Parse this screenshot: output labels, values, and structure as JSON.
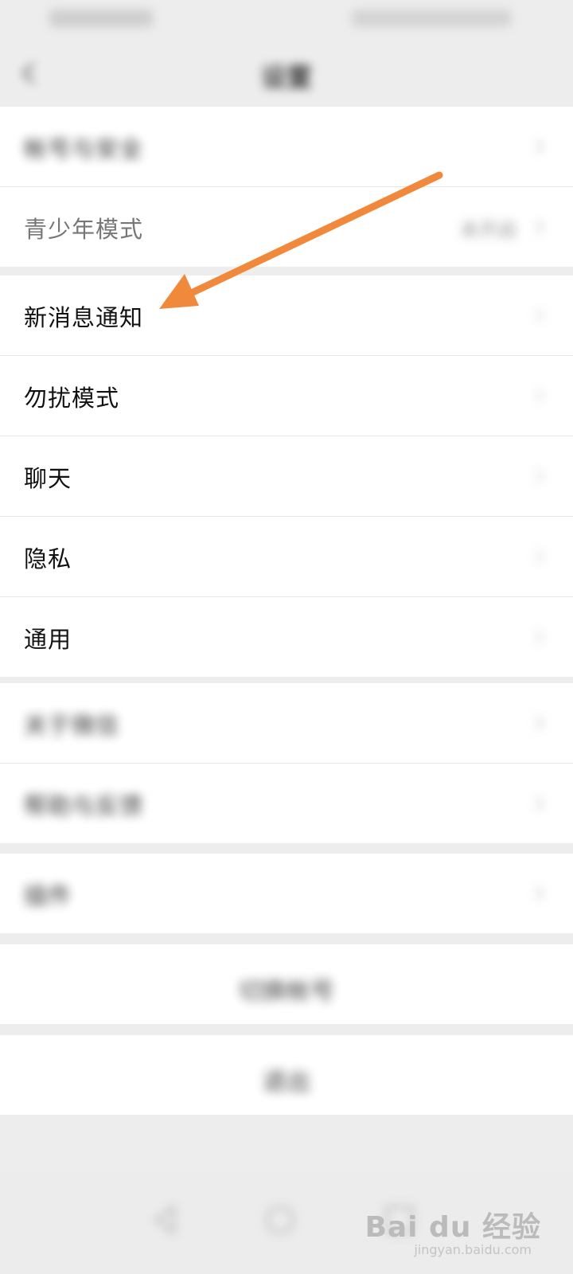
{
  "nav": {
    "title": "设置"
  },
  "groups": {
    "account": {
      "items": [
        {
          "label": "帐号与安全"
        },
        {
          "label": "青少年模式",
          "value": "未开启"
        }
      ]
    },
    "main": {
      "items": [
        {
          "label": "新消息通知"
        },
        {
          "label": "勿扰模式"
        },
        {
          "label": "聊天"
        },
        {
          "label": "隐私"
        },
        {
          "label": "通用"
        }
      ]
    },
    "about": {
      "items": [
        {
          "label": "关于微信"
        },
        {
          "label": "帮助与反馈"
        }
      ]
    },
    "plugins": {
      "items": [
        {
          "label": "插件"
        }
      ]
    }
  },
  "actions": {
    "switch_account": "切换帐号",
    "logout": "退出"
  },
  "watermark": {
    "brand": "Bai du 经验",
    "url": "jingyan.baidu.com"
  },
  "colors": {
    "arrow": "#f0893c",
    "background": "#ededed",
    "cell": "#ffffff"
  }
}
